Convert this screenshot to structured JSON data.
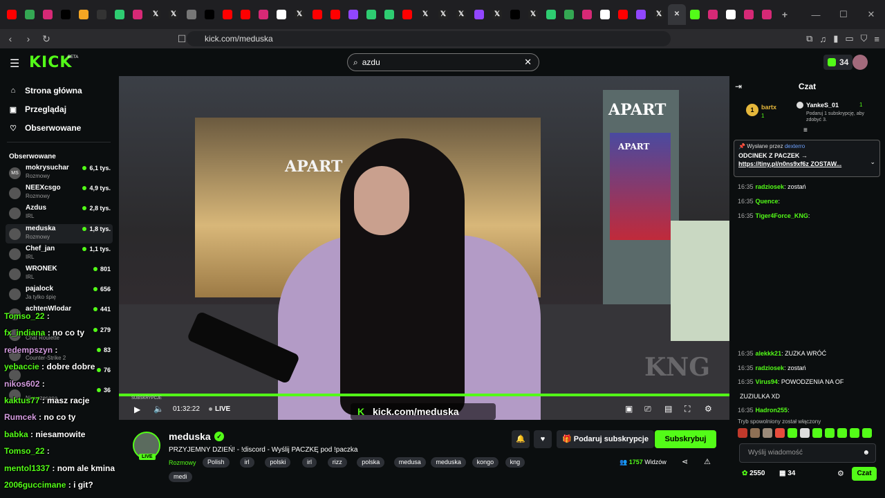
{
  "browser": {
    "url": "kick.com/meduska",
    "tab_icons": [
      {
        "icon": "youtube-icon",
        "color": "#ff0000"
      },
      {
        "icon": "maps-icon",
        "color": "#34a853"
      },
      {
        "icon": "instagram-icon",
        "color": "#d62976"
      },
      {
        "icon": "tiktok-icon",
        "color": "#000000"
      },
      {
        "icon": "generic-icon",
        "color": "#f5a623"
      },
      {
        "icon": "b-icon",
        "color": "#333333"
      },
      {
        "icon": "generic-icon",
        "color": "#2ecc71"
      },
      {
        "icon": "instagram-icon",
        "color": "#d62976"
      },
      {
        "icon": "x-icon",
        "color": "#222222"
      },
      {
        "icon": "x-icon",
        "color": "#222222"
      },
      {
        "icon": "generic-icon",
        "color": "#777777"
      },
      {
        "icon": "tiktok-icon",
        "color": "#000000"
      },
      {
        "icon": "youtube-icon",
        "color": "#ff0000"
      },
      {
        "icon": "youtube-icon",
        "color": "#ff0000"
      },
      {
        "icon": "instagram-icon",
        "color": "#d62976"
      },
      {
        "icon": "google-icon",
        "color": "#ffffff"
      },
      {
        "icon": "x-icon",
        "color": "#222222"
      },
      {
        "icon": "youtube-icon",
        "color": "#ff0000"
      },
      {
        "icon": "youtube-icon",
        "color": "#ff0000"
      },
      {
        "icon": "twitch-icon",
        "color": "#9146ff"
      },
      {
        "icon": "generic-icon",
        "color": "#2ecc71"
      },
      {
        "icon": "generic-icon",
        "color": "#2ecc71"
      },
      {
        "icon": "youtube-icon",
        "color": "#ff0000"
      },
      {
        "icon": "x-icon",
        "color": "#222222"
      },
      {
        "icon": "x-icon",
        "color": "#222222"
      },
      {
        "icon": "x-icon",
        "color": "#222222"
      },
      {
        "icon": "twitch-icon",
        "color": "#9146ff"
      },
      {
        "icon": "x-icon",
        "color": "#222222"
      },
      {
        "icon": "tiktok-icon",
        "color": "#000000"
      },
      {
        "icon": "x-icon",
        "color": "#222222"
      },
      {
        "icon": "generic-icon",
        "color": "#2ecc71"
      },
      {
        "icon": "maps-icon",
        "color": "#34a853"
      },
      {
        "icon": "instagram-icon",
        "color": "#d62976"
      },
      {
        "icon": "google-icon",
        "color": "#ffffff"
      },
      {
        "icon": "youtube-icon",
        "color": "#ff0000"
      },
      {
        "icon": "twitch-icon",
        "color": "#9146ff"
      },
      {
        "icon": "x-icon",
        "color": "#222222"
      },
      {
        "icon": "close-icon",
        "color": "#35363a"
      },
      {
        "icon": "kick-icon",
        "color": "#53fc18"
      },
      {
        "icon": "instagram-icon",
        "color": "#d62976"
      },
      {
        "icon": "google-icon",
        "color": "#ffffff"
      },
      {
        "icon": "instagram-icon",
        "color": "#d62976"
      },
      {
        "icon": "instagram-icon",
        "color": "#d62976"
      }
    ]
  },
  "header": {
    "search_value": "azdu",
    "kicks": "34"
  },
  "sidebar": {
    "nav": [
      {
        "label": "Strona główna",
        "icon": "home-icon"
      },
      {
        "label": "Przeglądaj",
        "icon": "browse-icon"
      },
      {
        "label": "Obserwowane",
        "icon": "heart-icon"
      }
    ],
    "followed_title": "Obserwowane",
    "followed": [
      {
        "name": "mokrysuchar",
        "category": "Rozmowy",
        "viewers": "6,1 tys.",
        "avatar": "MS"
      },
      {
        "name": "NEEXcsgo",
        "category": "Rozmowy",
        "viewers": "4,9 tys.",
        "avatar": ""
      },
      {
        "name": "Azdus",
        "category": "IRL",
        "viewers": "2,8 tys.",
        "avatar": ""
      },
      {
        "name": "meduska",
        "category": "Rozmowy",
        "viewers": "1,8 tys.",
        "avatar": ""
      },
      {
        "name": "Chef_jan",
        "category": "IRL",
        "viewers": "1,1 tys.",
        "avatar": ""
      },
      {
        "name": "WRONEK",
        "category": "IRL",
        "viewers": "801",
        "avatar": ""
      },
      {
        "name": "pajalock",
        "category": "Ja tylko śpię",
        "viewers": "656",
        "avatar": ""
      },
      {
        "name": "achtenWlodar",
        "category": "",
        "viewers": "441",
        "avatar": ""
      },
      {
        "name": "",
        "category": "Chat Roulette",
        "viewers": "279",
        "avatar": ""
      },
      {
        "name": "",
        "category": "Counter-Strike 2",
        "viewers": "83",
        "avatar": ""
      },
      {
        "name": "",
        "category": "",
        "viewers": "76",
        "avatar": ""
      },
      {
        "name": "",
        "category": "Nieuczesana",
        "viewers": "36",
        "avatar": ""
      }
    ]
  },
  "video": {
    "shop_sign": "APART",
    "pillar_sign": "APART",
    "poster_sign": "APART",
    "watermark": "kick.com/meduska",
    "subs_badge": "SUBSKRYPCJE",
    "timer": "01:32:22",
    "live": "LIVE",
    "kng": "KNG"
  },
  "stream": {
    "name": "meduska",
    "live_badge": "LIVE",
    "title": "PRZYJEMNY DZIEŃ! - !discord - Wyślij PACZKĘ pod !paczka",
    "category": "Rozmowy",
    "tags": [
      "Polish",
      "irl",
      "polski",
      "irl",
      "rizz",
      "polska",
      "medusa",
      "meduska",
      "kongo",
      "kng",
      "medi"
    ],
    "gift_label": "Podaruj subskrypcje",
    "subscribe_label": "Subskrybuj",
    "viewers": "1757",
    "viewers_label": "Widzów"
  },
  "chat": {
    "title": "Czat",
    "leader_1": {
      "name": "bartx",
      "count": "1"
    },
    "leader_2": {
      "name": "YankeS_01",
      "count": "1",
      "note": "Podaruj 1 subskrypcję, aby zdobyć 3."
    },
    "pinned": {
      "by_label": "Wysłane przez",
      "by_user": "dexterro",
      "line1": "ODCINEK Z PACZEK →",
      "line2": "https://tiny.pl/n0ns9xf6z ZOSTAW..."
    },
    "messages_top": [
      {
        "time": "16:35",
        "user": "radziosek",
        "text": "zostań"
      },
      {
        "time": "16:35",
        "user": "Quence",
        "text": ""
      },
      {
        "time": "16:35",
        "user": "Tiger4Force_KNG",
        "text": ""
      }
    ],
    "messages_bottom": [
      {
        "time": "16:35",
        "user": "alekkk21",
        "text": "ZUZKA WRÓĆ"
      },
      {
        "time": "16:35",
        "user": "radziosek",
        "text": "zostań"
      },
      {
        "time": "16:35",
        "user": "Virus94",
        "text": "POWODZENIA NA OF"
      },
      {
        "time": "",
        "user": "",
        "text": "ZUZIULKA XD"
      },
      {
        "time": "16:35",
        "user": "Hadron255",
        "text": ""
      }
    ],
    "slowmode": "Tryb spowolniony został włączony",
    "input_placeholder": "Wyślij wiadomość",
    "points": "2550",
    "points2": "34",
    "send_label": "Czat"
  },
  "overlay_chat": [
    {
      "user": "Tomso_22",
      "text": "",
      "pink": false
    },
    {
      "user": "fx_indiana",
      "text": "no co ty",
      "pink": false
    },
    {
      "user": "redempszyn",
      "text": "",
      "pink": true
    },
    {
      "user": "yebaccie",
      "text": "dobre dobre",
      "pink": false
    },
    {
      "user": "nikos602",
      "text": "",
      "pink": true
    },
    {
      "user": "kaktus77",
      "text": "masz racje",
      "pink": false
    },
    {
      "user": "Rumcek",
      "text": "no co ty",
      "pink": true
    },
    {
      "user": "babka",
      "text": "niesamowite",
      "pink": false
    },
    {
      "user": "Tomso_22",
      "text": "",
      "pink": false
    },
    {
      "user": "mentol1337",
      "text": "nom ale kmina",
      "pink": false
    },
    {
      "user": "2006guccimane",
      "text": "i git?",
      "pink": false
    }
  ]
}
